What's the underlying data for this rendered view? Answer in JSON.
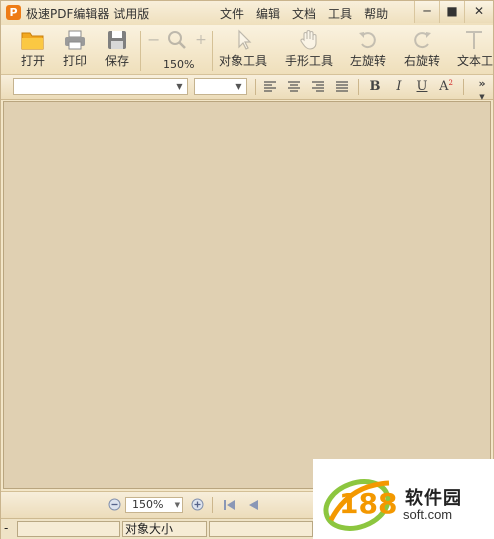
{
  "app": {
    "logo": "P",
    "title": "极速PDF编辑器 试用版"
  },
  "menu": [
    "文件",
    "编辑",
    "文档",
    "工具",
    "帮助"
  ],
  "window_controls": {
    "minimize": "─",
    "maximize": "■",
    "close": "✕"
  },
  "toolbar": {
    "open": "打开",
    "print": "打印",
    "save": "保存",
    "zoom_out": "−",
    "zoom_in": "+",
    "zoom": "150%",
    "select": "对象工具",
    "hand": "手形工具",
    "rotate_left": "左旋转",
    "rotate_right": "右旋转",
    "text": "文本工"
  },
  "format": {
    "font_value": "",
    "size_value": "",
    "bold": "B",
    "italic": "I",
    "underline": "U",
    "superscript": "A",
    "superscript_mark": "2",
    "more": "»"
  },
  "nav": {
    "zoom": "150%"
  },
  "status": {
    "mode": "-",
    "object_size": "对象大小"
  },
  "watermark": {
    "digits": "188",
    "name": "软件园",
    "domain": "soft.com"
  },
  "colors": {
    "accent": "#ee7c16",
    "doc_bg": "#e0d0b2",
    "chrome": "#f3e6c8"
  }
}
